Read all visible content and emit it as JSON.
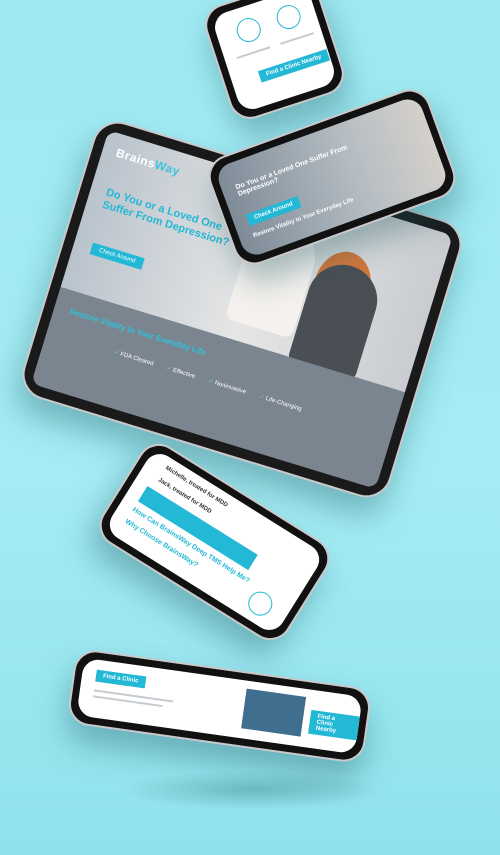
{
  "tablet": {
    "logo_prefix": "Brains",
    "logo_suffix": "Way",
    "hero_title": "Do You or a Loved One Suffer From Depression?",
    "cta": "Check Around",
    "tagline": "Restore Vitality to Your Everyday Life",
    "features": [
      "FDA Cleared",
      "Effective",
      "Noninvasive",
      "Life-Changing"
    ]
  },
  "phone_top": {
    "cta": "Find a Clinic Nearby"
  },
  "phone_mid": {
    "title": "Do You or a Loved One Suffer From Depression?",
    "cta": "Check Around",
    "tagline": "Restore Vitality to Your Everyday Life"
  },
  "phone_low": {
    "quote1_author": "Michelle, treated for MDD",
    "quote2_author": "Jack, treated for MDD",
    "section1": "How Can BrainsWay Deep TMS Help Me?",
    "section2": "Why Choose BrainsWay?"
  },
  "phone_bot": {
    "cta_left": "Find a Clinic",
    "cta_right": "Find a Clinic Nearby"
  }
}
